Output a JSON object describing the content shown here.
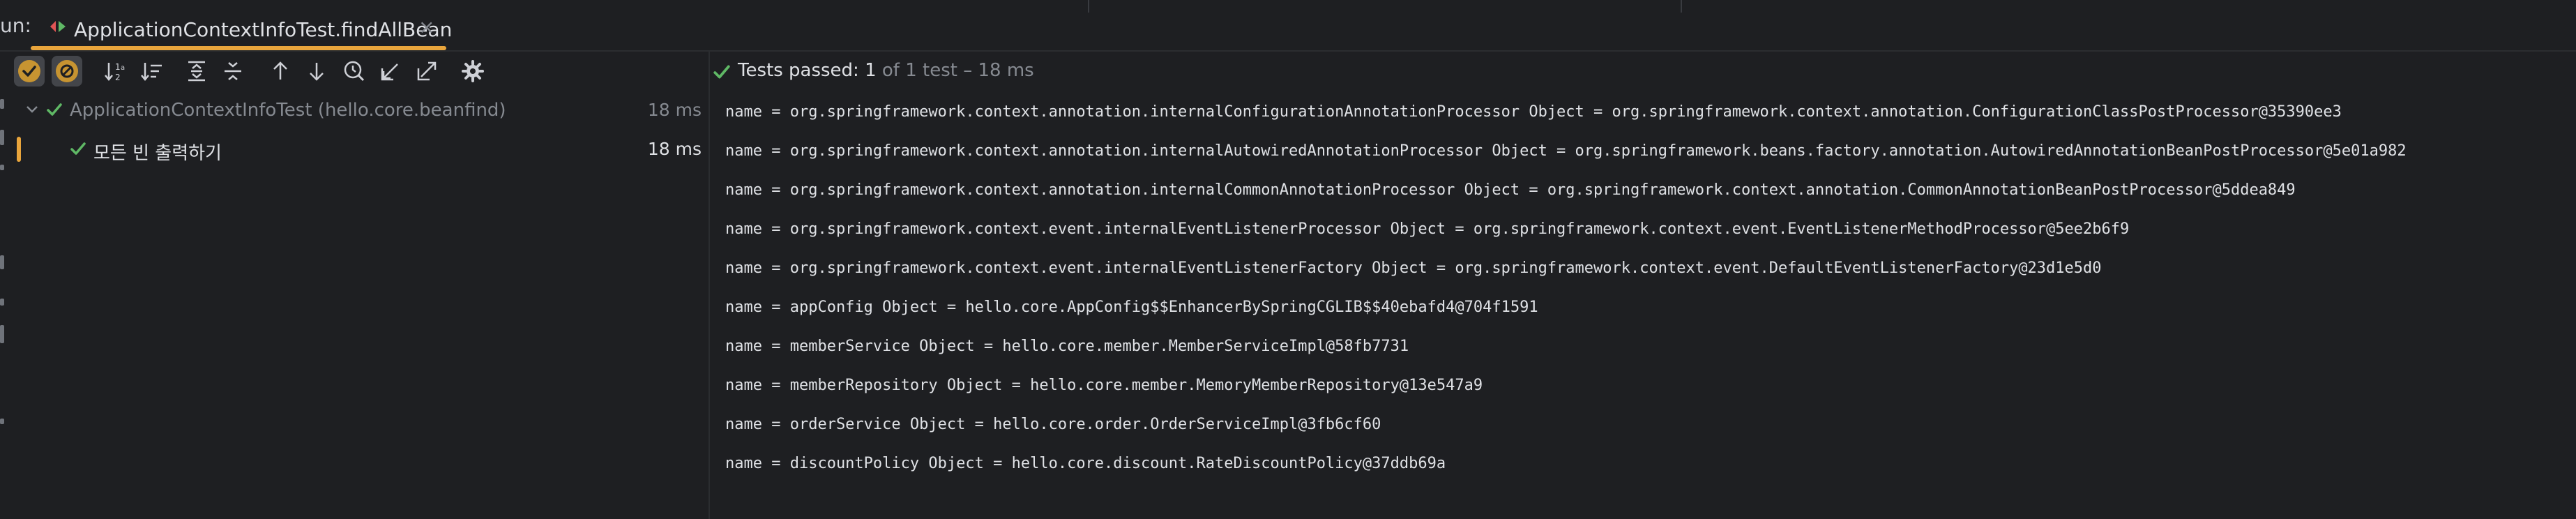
{
  "run_panel": {
    "label": "un:",
    "tab_title": "ApplicationContextInfoTest.findAllBean",
    "close_glyph": "×"
  },
  "toolbar": {
    "buttons": [
      {
        "name": "show-passed-toggle",
        "icon": "check-circle-icon",
        "active": true
      },
      {
        "name": "show-ignored-toggle",
        "icon": "ignored-circle-icon",
        "active": true
      },
      {
        "name": "sort-alphabetically",
        "icon": "sort-alpha-icon"
      },
      {
        "name": "sort-by-duration",
        "icon": "sort-duration-icon"
      },
      {
        "name": "expand-all",
        "icon": "expand-all-icon"
      },
      {
        "name": "collapse-all",
        "icon": "collapse-all-icon"
      },
      {
        "name": "previous-failed-test",
        "icon": "arrow-up-icon"
      },
      {
        "name": "next-failed-test",
        "icon": "arrow-down-icon"
      },
      {
        "name": "test-history",
        "icon": "clock-search-icon"
      },
      {
        "name": "import-tests",
        "icon": "import-icon"
      },
      {
        "name": "export-tests",
        "icon": "export-icon"
      },
      {
        "name": "settings",
        "icon": "gear-icon"
      }
    ]
  },
  "tree": {
    "suite": {
      "label": "ApplicationContextInfoTest (hello.core.beanfind)",
      "duration": "18 ms"
    },
    "test": {
      "label": "모든 빈 출력하기",
      "duration": "18 ms"
    }
  },
  "status": {
    "passed_label": "Tests passed:",
    "passed_count": "1",
    "passed_detail": "of 1 test – 18 ms"
  },
  "console": {
    "lines": [
      "name = org.springframework.context.annotation.internalConfigurationAnnotationProcessor Object = org.springframework.context.annotation.ConfigurationClassPostProcessor@35390ee3",
      "name = org.springframework.context.annotation.internalAutowiredAnnotationProcessor Object = org.springframework.beans.factory.annotation.AutowiredAnnotationBeanPostProcessor@5e01a982",
      "name = org.springframework.context.annotation.internalCommonAnnotationProcessor Object = org.springframework.context.annotation.CommonAnnotationBeanPostProcessor@5ddea849",
      "name = org.springframework.context.event.internalEventListenerProcessor Object = org.springframework.context.event.EventListenerMethodProcessor@5ee2b6f9",
      "name = org.springframework.context.event.internalEventListenerFactory Object = org.springframework.context.event.DefaultEventListenerFactory@23d1e5d0",
      "name = appConfig Object = hello.core.AppConfig$$EnhancerBySpringCGLIB$$40ebafd4@704f1591",
      "name = memberService Object = hello.core.member.MemberServiceImpl@58fb7731",
      "name = memberRepository Object = hello.core.member.MemoryMemberRepository@13e547a9",
      "name = orderService Object = hello.core.order.OrderServiceImpl@3fb6cf60",
      "name = discountPolicy Object = hello.core.discount.RateDiscountPolicy@37ddb69a"
    ]
  },
  "colors": {
    "background": "#1e1f22",
    "accent_orange": "#e9a53c",
    "pass_green": "#5fb865",
    "text": "#dfe1e5",
    "muted": "#868a91"
  }
}
